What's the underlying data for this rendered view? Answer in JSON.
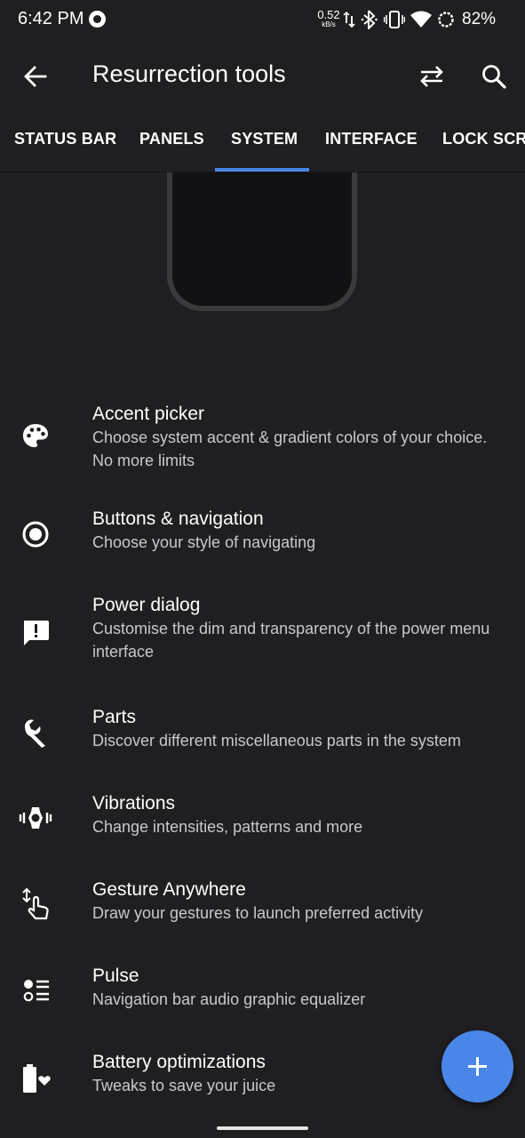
{
  "status_bar": {
    "time": "6:42 PM",
    "net_speed": "0.52",
    "net_speed_unit": "kB/s",
    "battery_percent": "82%",
    "icons": [
      "p-icon",
      "data-arrows-icon",
      "bluetooth-icon",
      "vibrate-icon",
      "wifi-icon",
      "battery-ring-icon"
    ]
  },
  "app_bar": {
    "title": "Resurrection tools",
    "icons": [
      "back-arrow-icon",
      "swap-icon",
      "search-icon"
    ]
  },
  "tabs": [
    {
      "label": "STATUS BAR",
      "selected": false
    },
    {
      "label": "PANELS",
      "selected": false
    },
    {
      "label": "SYSTEM",
      "selected": true
    },
    {
      "label": "INTERFACE",
      "selected": false
    },
    {
      "label": "LOCK SCREEN",
      "selected": false
    }
  ],
  "items": [
    {
      "icon": "palette-icon",
      "title": "Accent picker",
      "summary": "Choose system accent & gradient colors of your choice. No more limits"
    },
    {
      "icon": "radio-button-icon",
      "title": "Buttons & navigation",
      "summary": "Choose your style of navigating"
    },
    {
      "icon": "feedback-icon",
      "title": "Power dialog",
      "summary": "Customise the dim and transparency of the power menu interface"
    },
    {
      "icon": "wrench-icon",
      "title": "Parts",
      "summary": "Discover different miscellaneous parts in the system"
    },
    {
      "icon": "vibration-icon",
      "title": "Vibrations",
      "summary": "Change intensities, patterns and more"
    },
    {
      "icon": "swipe-gesture-icon",
      "title": "Gesture Anywhere",
      "summary": "Draw your gestures to launch preferred activity"
    },
    {
      "icon": "list-toggle-icon",
      "title": "Pulse",
      "summary": "Navigation bar audio graphic equalizer"
    },
    {
      "icon": "battery-heart-icon",
      "title": "Battery optimizations",
      "summary": "Tweaks to save your juice"
    }
  ],
  "fab": {
    "icon": "plus-icon"
  },
  "colors": {
    "background": "#1f1f22",
    "accent": "#4a86e8",
    "text_primary": "#ffffff",
    "text_secondary": "#c9c9cc"
  }
}
